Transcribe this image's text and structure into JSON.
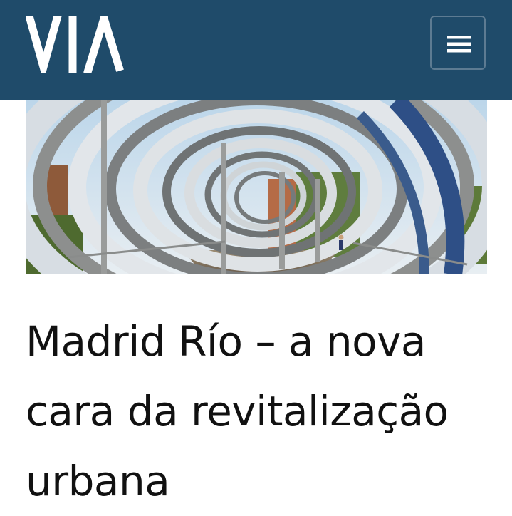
{
  "header": {
    "logo_text": "VIA",
    "logo_icon": "via-logo",
    "menu_icon": "hamburger-icon",
    "background_color": "#1f4b6a"
  },
  "hero": {
    "image_subject": "curved steel arches of a pedestrian bridge with a walking person"
  },
  "article": {
    "title": "Madrid Río – a nova cara da revitalização urbana"
  }
}
